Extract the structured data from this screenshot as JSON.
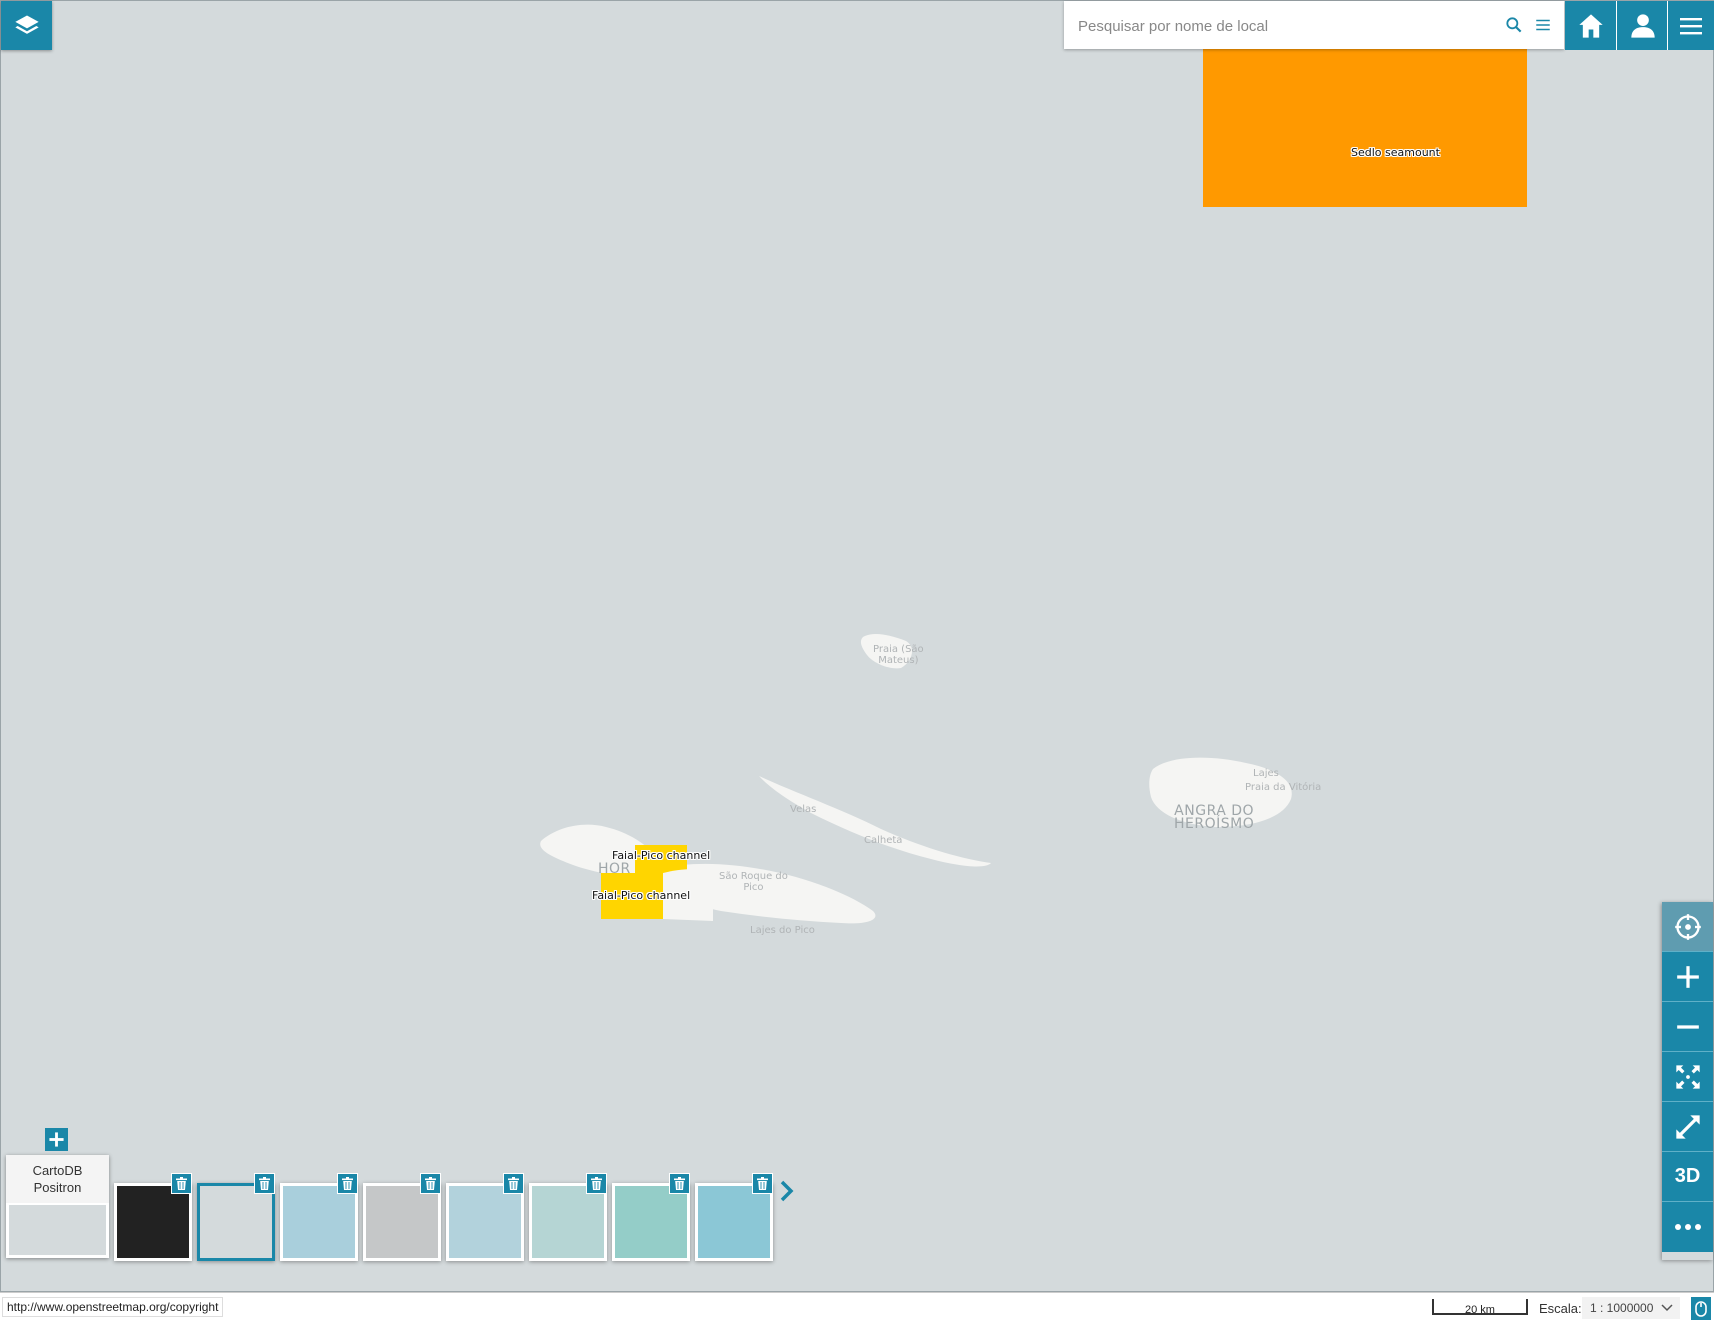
{
  "search": {
    "placeholder": "Pesquisar por nome de local"
  },
  "map": {
    "places": [
      {
        "name": "Praia (São\nMateus)"
      },
      {
        "name": "Velas"
      },
      {
        "name": "Calheta"
      },
      {
        "name": "São Roque do\nPico"
      },
      {
        "name": "Lajes do Pico"
      },
      {
        "name": "HOR"
      },
      {
        "name": "Lajes"
      },
      {
        "name": "Praia da Vitória"
      },
      {
        "name": "ANGRA DO\nHEROÍSMO"
      }
    ],
    "areas": [
      {
        "label": "Sedlo seamount",
        "color": "#ff9900"
      },
      {
        "label": "Faial-Pico channel",
        "color": "#ffd500"
      },
      {
        "label": "Faial-Pico channel",
        "color": "#ffd500"
      }
    ]
  },
  "background_selector": {
    "current_label": "CartoDB\nPositron",
    "thumbnails": [
      {
        "color": "#222222"
      },
      {
        "color": "#d4dadc"
      },
      {
        "color": "#a9cfdc"
      },
      {
        "color": "#c5c7c8"
      },
      {
        "color": "#b2d2dc"
      },
      {
        "color": "#b5d5d4"
      },
      {
        "color": "#94cdc8"
      },
      {
        "color": "#8bc7d6"
      }
    ]
  },
  "toolbar": {
    "btn_3d": "3D"
  },
  "footer": {
    "attribution": "http://www.openstreetmap.org/copyright",
    "scale_bar": "20 km",
    "scale_label": "Escala:",
    "scale_value": "1 : 1000000"
  },
  "colors": {
    "accent": "#1a87a8",
    "sea": "#d4dadc",
    "land": "#f5f5f3"
  }
}
